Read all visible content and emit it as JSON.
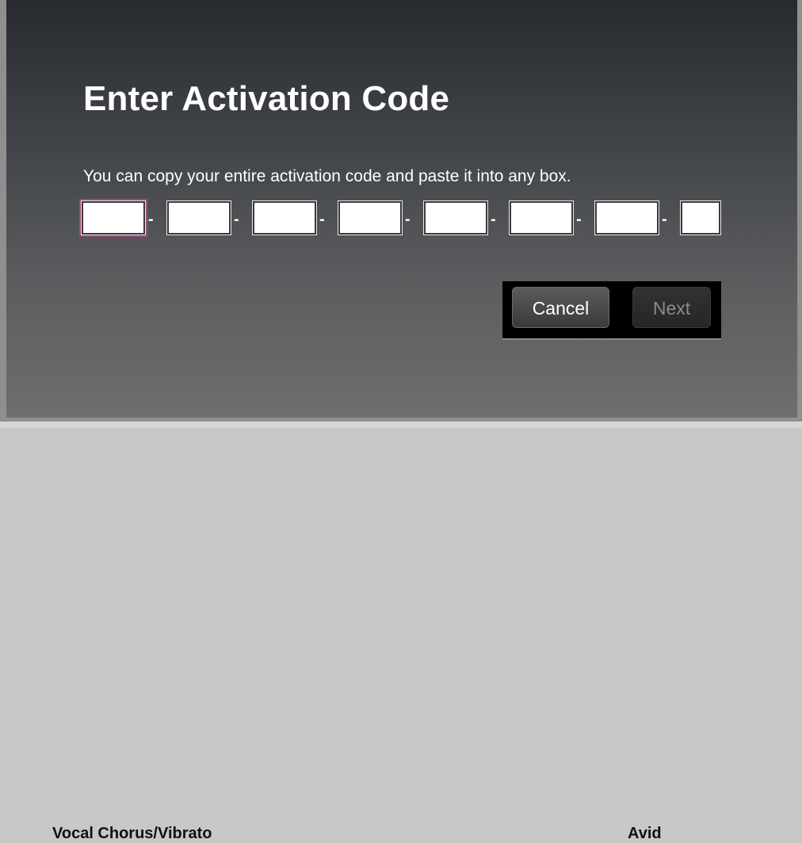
{
  "background": {
    "row_left_text": "Vocal Chorus/Vibrato",
    "row_right_text": "Avid"
  },
  "dialog": {
    "title": "Enter Activation Code",
    "hint": "You can copy your entire activation code and paste it into any box.",
    "separator": "-",
    "code_fields": [
      {
        "value": "",
        "focused": true
      },
      {
        "value": ""
      },
      {
        "value": ""
      },
      {
        "value": ""
      },
      {
        "value": ""
      },
      {
        "value": ""
      },
      {
        "value": ""
      },
      {
        "value": ""
      }
    ],
    "buttons": {
      "cancel_label": "Cancel",
      "next_label": "Next",
      "next_enabled": false
    },
    "colors": {
      "focus_ring": "#9b4f78",
      "disabled_text": "#8b8b8b"
    }
  }
}
